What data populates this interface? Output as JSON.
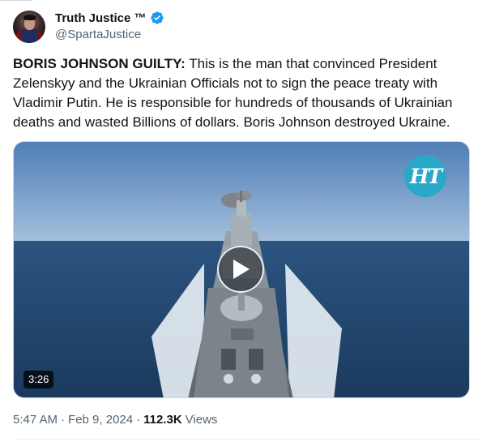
{
  "author": {
    "display_name": "Truth Justice ™",
    "handle": "@SpartaJustice",
    "verified": true,
    "avatar": "superhero-avatar"
  },
  "tweet": {
    "lead": "BORIS JOHNSON GUILTY:",
    "body": " This is the man that convinced President Zelenskyy and the Ukrainian Officials not to sign the peace treaty with Vladimir Putin. He is responsible for hundreds of thousands of Ukrainian deaths and wasted Billions of dollars. Boris Johnson destroyed Ukraine."
  },
  "media": {
    "type": "video",
    "duration": "3:26",
    "watermark": "HT",
    "scene": "warship-at-sea",
    "play_icon": "play-icon"
  },
  "meta": {
    "time": "5:47 AM",
    "separator": "·",
    "date": "Feb 9, 2024",
    "views_count": "112.3K",
    "views_label": "Views"
  },
  "colors": {
    "verified": "#1d9bf0",
    "text": "#0f1419",
    "secondary": "#536471",
    "ht_badge": "#29a8c9"
  }
}
